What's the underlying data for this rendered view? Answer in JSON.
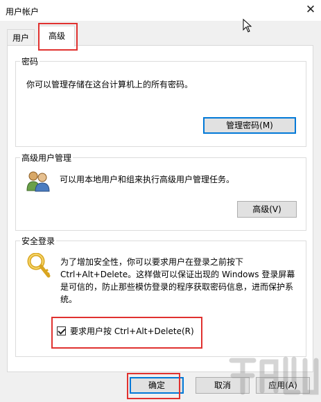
{
  "window": {
    "title": "用户帐户",
    "close_glyph": "✕"
  },
  "tabs": [
    {
      "label": "用户"
    },
    {
      "label": "高级"
    }
  ],
  "password_group": {
    "title": "密码",
    "description": "你可以管理存储在这台计算机上的所有密码。",
    "button": "管理密码(M)"
  },
  "advanced_user_group": {
    "title": "高级用户管理",
    "description": "可以用本地用户和组来执行高级用户管理任务。",
    "button": "高级(V)",
    "icon": "users-icon"
  },
  "secure_logon_group": {
    "title": "安全登录",
    "description": "为了增加安全性，你可以要求用户在登录之前按下 Ctrl+Alt+Delete。这样做可以保证出现的 Windows 登录屏幕是可信的，防止那些模仿登录的程序获取密码信息，进而保护系统。",
    "checkbox_label": "要求用户按 Ctrl+Alt+Delete(R)",
    "checkbox_checked": true,
    "icon": "key-icon"
  },
  "footer": {
    "ok": "确定",
    "cancel": "取消",
    "apply": "应用(A)"
  },
  "colors": {
    "highlight": "#e0312f",
    "focus": "#0078d7",
    "key": "#e0b020"
  }
}
